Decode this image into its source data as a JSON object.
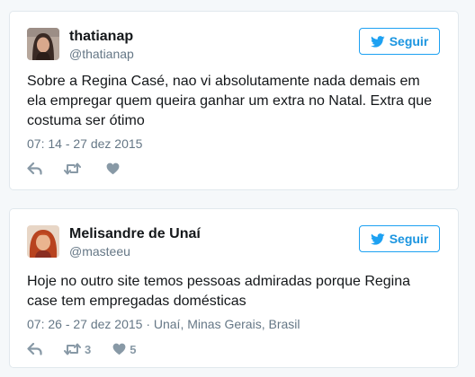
{
  "follow_label": "Seguir",
  "colors": {
    "accent": "#1da1f2",
    "text": "#14171a",
    "muted": "#657786",
    "icon": "#8899a6",
    "border": "#e1e8ed",
    "background": "#f5f8fa"
  },
  "tweets": [
    {
      "display_name": "thatianap",
      "handle": "@thatianap",
      "text": "Sobre a Regina Casé, nao vi absolutamente nada demais em ela empregar quem queira ganhar um extra no Natal. Extra que costuma ser ótimo",
      "meta": "07: 14 - 27 dez 2015",
      "retweets": "",
      "likes": ""
    },
    {
      "display_name": "Melisandre de Unaí",
      "handle": "@masteeu",
      "text": "Hoje no outro site temos pessoas admiradas porque Regina case tem empregadas domésticas",
      "meta": "07: 26 - 27 dez 2015 · Unaí, Minas Gerais, Brasil",
      "retweets": "3",
      "likes": "5"
    }
  ]
}
